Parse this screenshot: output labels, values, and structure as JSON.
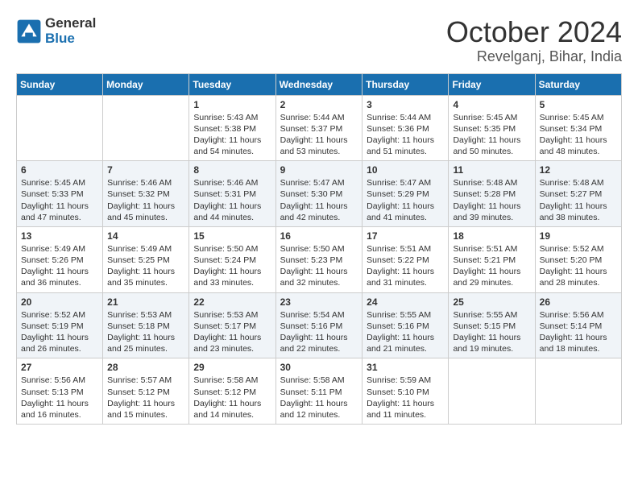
{
  "logo": {
    "text_general": "General",
    "text_blue": "Blue"
  },
  "title": "October 2024",
  "subtitle": "Revelganj, Bihar, India",
  "weekdays": [
    "Sunday",
    "Monday",
    "Tuesday",
    "Wednesday",
    "Thursday",
    "Friday",
    "Saturday"
  ],
  "weeks": [
    [
      {
        "day": "",
        "info": ""
      },
      {
        "day": "",
        "info": ""
      },
      {
        "day": "1",
        "info": "Sunrise: 5:43 AM\nSunset: 5:38 PM\nDaylight: 11 hours and 54 minutes."
      },
      {
        "day": "2",
        "info": "Sunrise: 5:44 AM\nSunset: 5:37 PM\nDaylight: 11 hours and 53 minutes."
      },
      {
        "day": "3",
        "info": "Sunrise: 5:44 AM\nSunset: 5:36 PM\nDaylight: 11 hours and 51 minutes."
      },
      {
        "day": "4",
        "info": "Sunrise: 5:45 AM\nSunset: 5:35 PM\nDaylight: 11 hours and 50 minutes."
      },
      {
        "day": "5",
        "info": "Sunrise: 5:45 AM\nSunset: 5:34 PM\nDaylight: 11 hours and 48 minutes."
      }
    ],
    [
      {
        "day": "6",
        "info": "Sunrise: 5:45 AM\nSunset: 5:33 PM\nDaylight: 11 hours and 47 minutes."
      },
      {
        "day": "7",
        "info": "Sunrise: 5:46 AM\nSunset: 5:32 PM\nDaylight: 11 hours and 45 minutes."
      },
      {
        "day": "8",
        "info": "Sunrise: 5:46 AM\nSunset: 5:31 PM\nDaylight: 11 hours and 44 minutes."
      },
      {
        "day": "9",
        "info": "Sunrise: 5:47 AM\nSunset: 5:30 PM\nDaylight: 11 hours and 42 minutes."
      },
      {
        "day": "10",
        "info": "Sunrise: 5:47 AM\nSunset: 5:29 PM\nDaylight: 11 hours and 41 minutes."
      },
      {
        "day": "11",
        "info": "Sunrise: 5:48 AM\nSunset: 5:28 PM\nDaylight: 11 hours and 39 minutes."
      },
      {
        "day": "12",
        "info": "Sunrise: 5:48 AM\nSunset: 5:27 PM\nDaylight: 11 hours and 38 minutes."
      }
    ],
    [
      {
        "day": "13",
        "info": "Sunrise: 5:49 AM\nSunset: 5:26 PM\nDaylight: 11 hours and 36 minutes."
      },
      {
        "day": "14",
        "info": "Sunrise: 5:49 AM\nSunset: 5:25 PM\nDaylight: 11 hours and 35 minutes."
      },
      {
        "day": "15",
        "info": "Sunrise: 5:50 AM\nSunset: 5:24 PM\nDaylight: 11 hours and 33 minutes."
      },
      {
        "day": "16",
        "info": "Sunrise: 5:50 AM\nSunset: 5:23 PM\nDaylight: 11 hours and 32 minutes."
      },
      {
        "day": "17",
        "info": "Sunrise: 5:51 AM\nSunset: 5:22 PM\nDaylight: 11 hours and 31 minutes."
      },
      {
        "day": "18",
        "info": "Sunrise: 5:51 AM\nSunset: 5:21 PM\nDaylight: 11 hours and 29 minutes."
      },
      {
        "day": "19",
        "info": "Sunrise: 5:52 AM\nSunset: 5:20 PM\nDaylight: 11 hours and 28 minutes."
      }
    ],
    [
      {
        "day": "20",
        "info": "Sunrise: 5:52 AM\nSunset: 5:19 PM\nDaylight: 11 hours and 26 minutes."
      },
      {
        "day": "21",
        "info": "Sunrise: 5:53 AM\nSunset: 5:18 PM\nDaylight: 11 hours and 25 minutes."
      },
      {
        "day": "22",
        "info": "Sunrise: 5:53 AM\nSunset: 5:17 PM\nDaylight: 11 hours and 23 minutes."
      },
      {
        "day": "23",
        "info": "Sunrise: 5:54 AM\nSunset: 5:16 PM\nDaylight: 11 hours and 22 minutes."
      },
      {
        "day": "24",
        "info": "Sunrise: 5:55 AM\nSunset: 5:16 PM\nDaylight: 11 hours and 21 minutes."
      },
      {
        "day": "25",
        "info": "Sunrise: 5:55 AM\nSunset: 5:15 PM\nDaylight: 11 hours and 19 minutes."
      },
      {
        "day": "26",
        "info": "Sunrise: 5:56 AM\nSunset: 5:14 PM\nDaylight: 11 hours and 18 minutes."
      }
    ],
    [
      {
        "day": "27",
        "info": "Sunrise: 5:56 AM\nSunset: 5:13 PM\nDaylight: 11 hours and 16 minutes."
      },
      {
        "day": "28",
        "info": "Sunrise: 5:57 AM\nSunset: 5:12 PM\nDaylight: 11 hours and 15 minutes."
      },
      {
        "day": "29",
        "info": "Sunrise: 5:58 AM\nSunset: 5:12 PM\nDaylight: 11 hours and 14 minutes."
      },
      {
        "day": "30",
        "info": "Sunrise: 5:58 AM\nSunset: 5:11 PM\nDaylight: 11 hours and 12 minutes."
      },
      {
        "day": "31",
        "info": "Sunrise: 5:59 AM\nSunset: 5:10 PM\nDaylight: 11 hours and 11 minutes."
      },
      {
        "day": "",
        "info": ""
      },
      {
        "day": "",
        "info": ""
      }
    ]
  ]
}
